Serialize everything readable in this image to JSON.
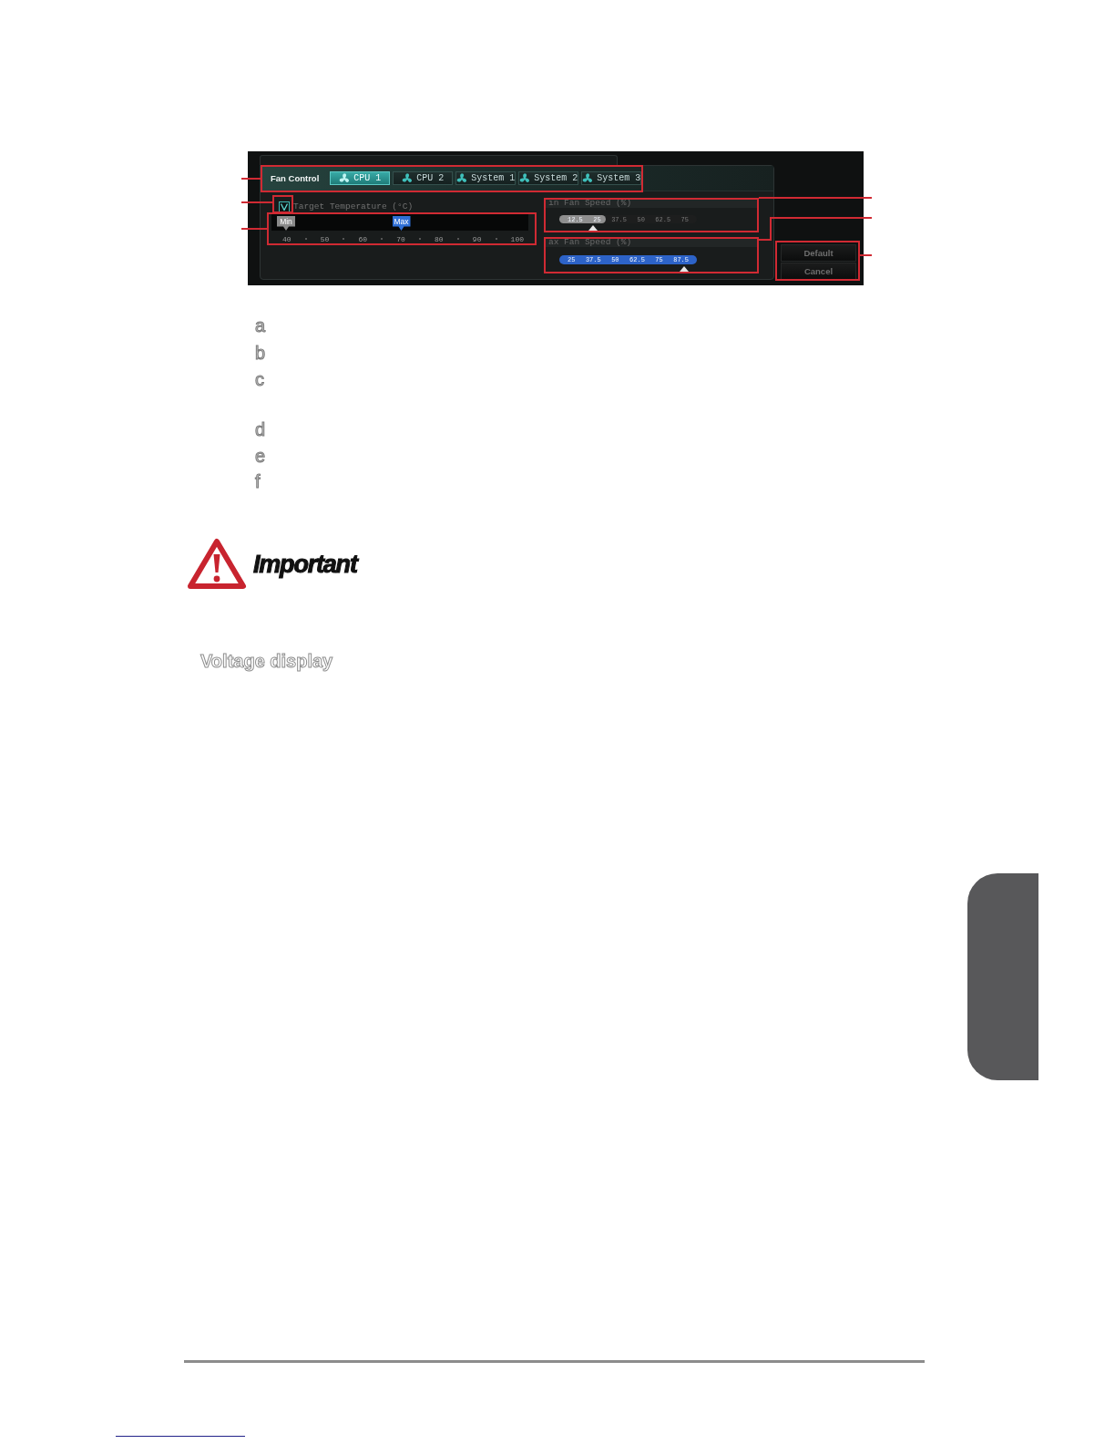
{
  "figure": {
    "tab_bar": {
      "title": "Fan Control",
      "tabs": [
        {
          "label": "CPU 1",
          "selected": true
        },
        {
          "label": "CPU 2",
          "selected": false
        },
        {
          "label": "System 1",
          "selected": false
        },
        {
          "label": "System 2",
          "selected": false
        },
        {
          "label": "System 3",
          "selected": false
        }
      ]
    },
    "target_temperature": {
      "label": "Target Temperature (°C)",
      "checked": true,
      "markers": [
        {
          "label": "Min",
          "color": "#8a8a8a",
          "level": 0
        },
        {
          "label": "Max",
          "color": "#2f6fd6",
          "level": 0.5
        }
      ],
      "ticks": [
        "40",
        "50",
        "60",
        "70",
        "80",
        "90",
        "100"
      ]
    },
    "fan_speed_sliders": [
      {
        "label": "in Fan Speed (%)",
        "color": "#8f8f8f",
        "level": 0.34,
        "values": [
          "12.5",
          "25",
          "37.5",
          "50",
          "62.5",
          "75"
        ]
      },
      {
        "label": "ax Fan Speed (%)",
        "color": "#2d63c8",
        "level": 1,
        "values": [
          "25",
          "37.5",
          "50",
          "62.5",
          "75",
          "87.5"
        ]
      }
    ],
    "buttons": [
      "Default",
      "Cancel"
    ]
  },
  "legend": [
    "a",
    "b",
    "c",
    "d",
    "e",
    "f"
  ],
  "important": "Important",
  "section_heading": "Voltage display"
}
